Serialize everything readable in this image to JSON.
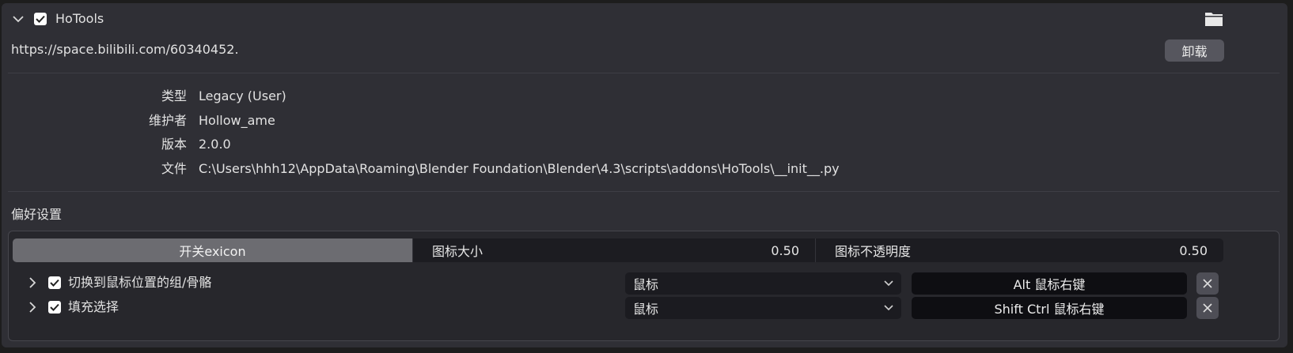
{
  "addon": {
    "name": "HoTools",
    "enabled": true,
    "expanded": true,
    "url": "https://space.bilibili.com/60340452.",
    "uninstall_label": "卸载"
  },
  "info": {
    "type_label": "类型",
    "type_value": "Legacy (User)",
    "maintainer_label": "维护者",
    "maintainer_value": "Hollow_ame",
    "version_label": "版本",
    "version_value": "2.0.0",
    "file_label": "文件",
    "file_value": "C:\\Users\\hhh12\\AppData\\Roaming\\Blender Foundation\\Blender\\4.3\\scripts\\addons\\HoTools\\__init__.py"
  },
  "preferences": {
    "title": "偏好设置",
    "toggle_label": "开关exicon",
    "icon_size_label": "图标大小",
    "icon_size_value": "0.50",
    "icon_opacity_label": "图标不透明度",
    "icon_opacity_value": "0.50"
  },
  "keymaps": [
    {
      "name": "切换到鼠标位置的组/骨骼",
      "enabled": true,
      "input_type": "鼠标",
      "key": "Alt 鼠标右键"
    },
    {
      "name": "填充选择",
      "enabled": true,
      "input_type": "鼠标",
      "key": "Shift Ctrl 鼠标右键"
    }
  ],
  "icons": {
    "expand": "chevron-down-icon",
    "collapsed": "chevron-right-icon",
    "folder": "folder-icon",
    "dropdown": "chevron-down-icon",
    "remove": "close-icon",
    "checkbox": "checkbox-icon"
  },
  "colors": {
    "panel_bg": "#2f2f35",
    "window_bg": "#1d1d1d",
    "active_segment": "#6c6c71",
    "key_button": "#0e0e12"
  }
}
